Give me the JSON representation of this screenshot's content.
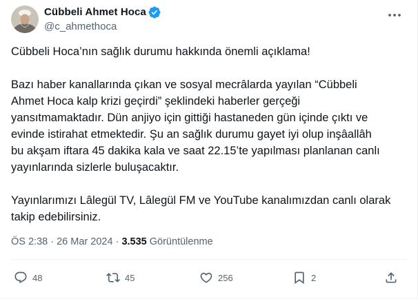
{
  "author": {
    "name": "Cübbeli Ahmet Hoca",
    "handle": "@c_ahmethoca"
  },
  "tweet": {
    "paragraphs": [
      [
        "Cübbeli Hoca’nın sağlık durumu hakkında önemli açıklama!"
      ],
      [
        "Bazı haber kanallarında çıkan ve sosyal mecrâlarda yayılan “Cübbeli",
        "Ahmet Hoca kalp krizi geçirdi” şeklindeki haberler gerçeği",
        "yansıtmamaktadır. Dün anjiyo için gittiği hastaneden gün içinde çıktı ve",
        "evinde istirahat etmektedir. Şu an sağlık durumu gayet iyi olup inşâallâh",
        "bu akşam iftara 45 dakika kala ve saat 22.15’te yapılması planlanan canlı",
        "yayınlarında sizlerle buluşacaktır."
      ],
      [
        "Yayınlarımızı Lâlegül TV, Lâlegül FM ve YouTube kanalımızdan canlı olarak",
        "takip edebilirsiniz."
      ]
    ]
  },
  "meta": {
    "time": "ÖS 2:38",
    "separator": "·",
    "date": "26 Mar 2024",
    "views_count": "3.535",
    "views_label": "Görüntülenme"
  },
  "actions": {
    "replies": "48",
    "reposts": "45",
    "likes": "256",
    "bookmarks": "2"
  },
  "colors": {
    "verified": "#1d9bf0",
    "secondary_text": "#536471",
    "primary_text": "#0f1419"
  }
}
